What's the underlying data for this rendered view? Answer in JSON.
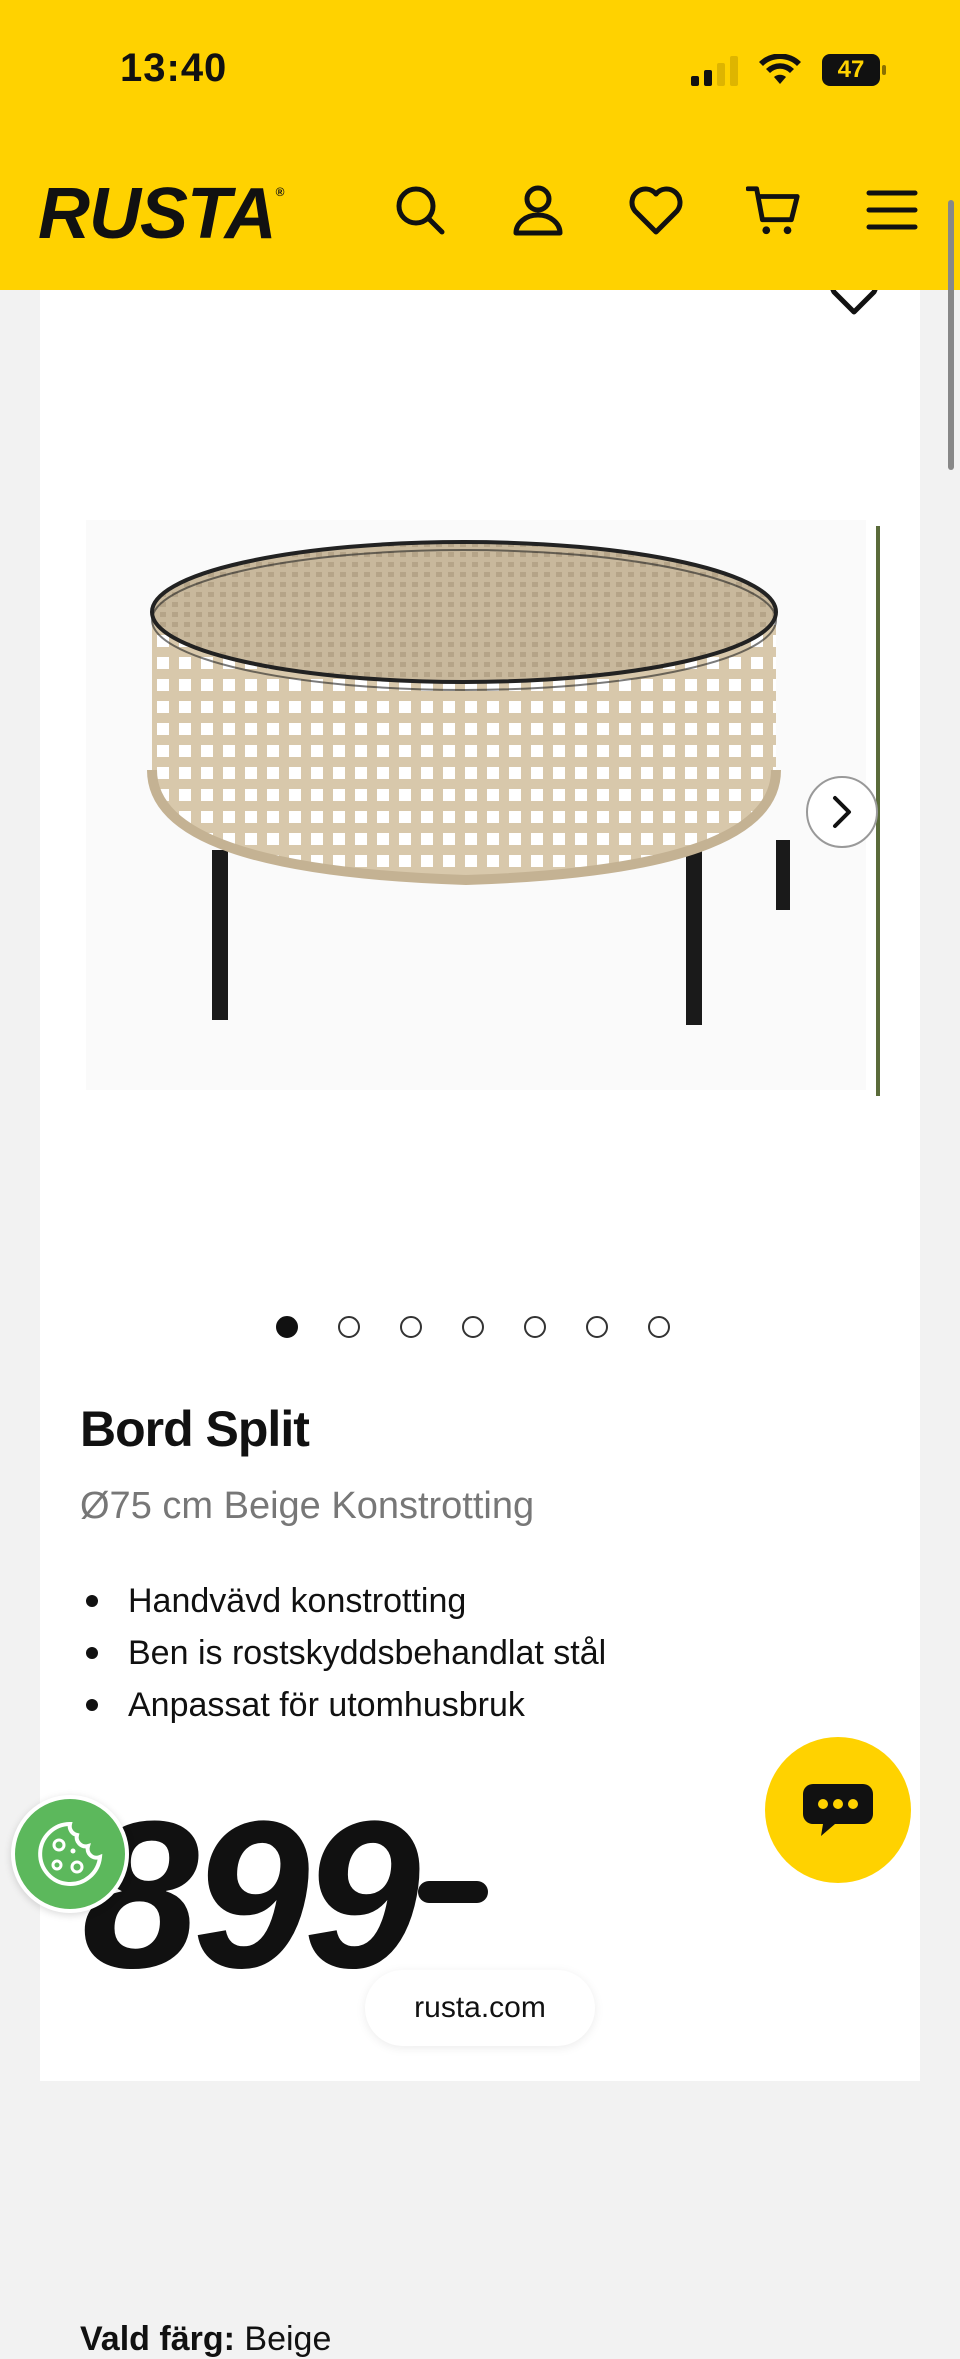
{
  "status_bar": {
    "time": "13:40",
    "battery": "47"
  },
  "header": {
    "logo": "RUSTA",
    "icons": [
      "search-icon",
      "account-icon",
      "heart-icon",
      "cart-icon",
      "menu-icon"
    ]
  },
  "gallery": {
    "total_images": 7,
    "active_index": 0
  },
  "product": {
    "title": "Bord Split",
    "subtitle": "Ø75 cm Beige Konstrotting",
    "features": [
      "Handvävd konstrotting",
      "Ben is rostskyddsbehandlat stål",
      "Anpassat för utomhusbruk"
    ],
    "price": "899",
    "color_label": "Vald färg:",
    "color_value": "Beige"
  },
  "browser": {
    "url": "rusta.com"
  },
  "colors": {
    "brand_yellow": "#ffd200",
    "cookie_green": "#5cb85c"
  }
}
